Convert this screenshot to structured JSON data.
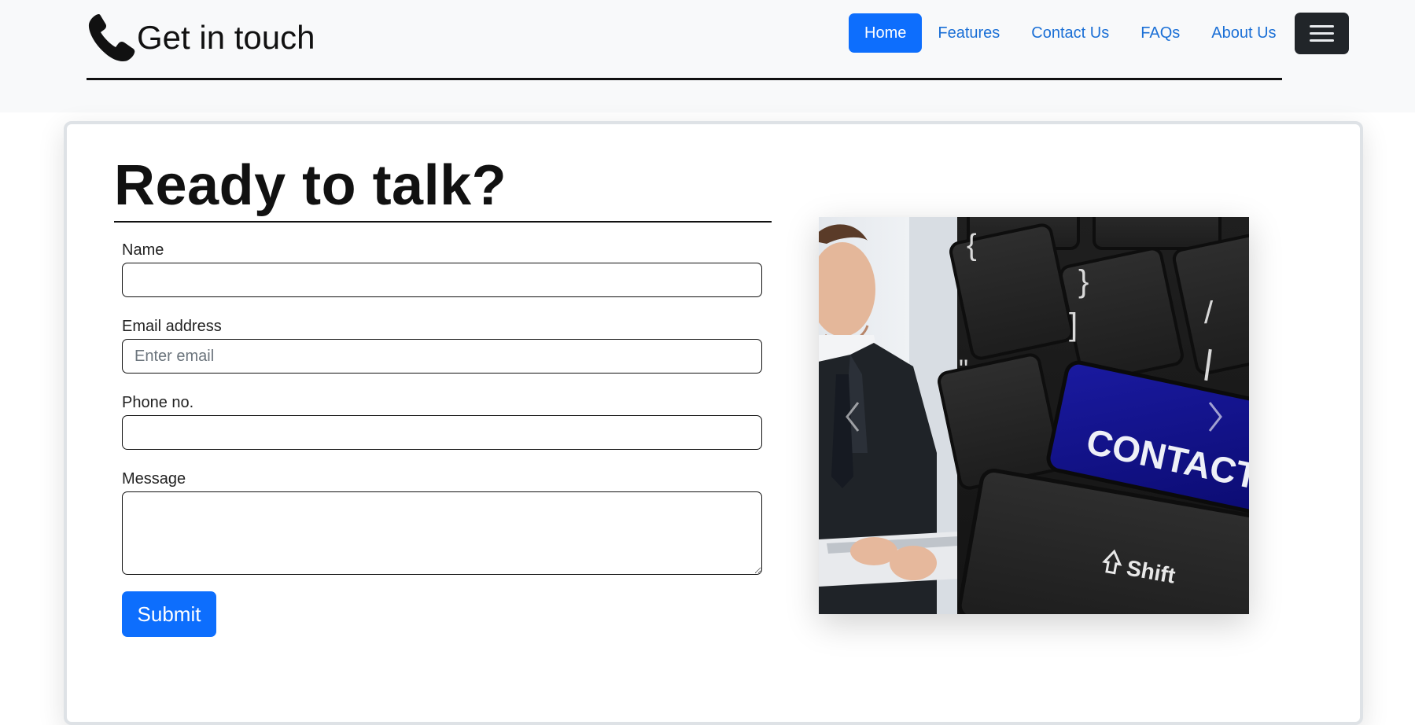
{
  "brand": {
    "icon": "phone-icon",
    "title": "Get in touch"
  },
  "nav": {
    "links": [
      {
        "label": "Home",
        "active": true
      },
      {
        "label": "Features",
        "active": false
      },
      {
        "label": "Contact Us",
        "active": false
      },
      {
        "label": "FAQs",
        "active": false
      },
      {
        "label": "About Us",
        "active": false
      }
    ],
    "toggler_icon": "hamburger-menu-icon",
    "active_color": "#0d6efd",
    "link_color": "#1a6fd6"
  },
  "form": {
    "heading": "Ready to talk?",
    "name_label": "Name",
    "name_value": "",
    "email_label": "Email address",
    "email_placeholder": "Enter email",
    "phone_label": "Phone no.",
    "phone_value": "",
    "message_label": "Message",
    "message_value": "",
    "submit_label": "Submit"
  },
  "carousel": {
    "slide_images": [
      "businessman-with-tablet-image",
      "keyboard-contact-key-image"
    ],
    "key_text": "CONTACT",
    "shift_text": "Shift",
    "prev_icon": "chevron-left-icon",
    "next_icon": "chevron-right-icon"
  }
}
